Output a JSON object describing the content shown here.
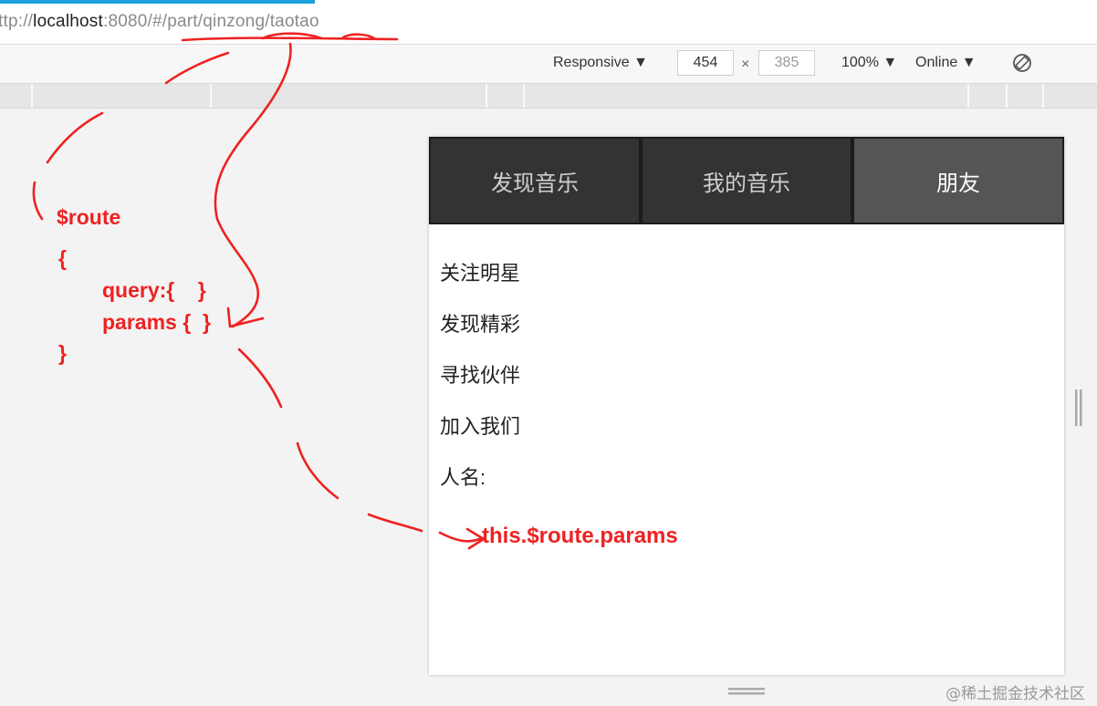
{
  "browser": {
    "url_prefix": "ttp://",
    "url_host": "localhost",
    "url_rest": ":8080/#/part/qinzong/taotao"
  },
  "devtools": {
    "device": "Responsive",
    "width": "454",
    "times": "×",
    "height": "385",
    "zoom": "100%",
    "network": "Online"
  },
  "app": {
    "tabs": [
      {
        "label": "发现音乐"
      },
      {
        "label": "我的音乐"
      },
      {
        "label": "朋友"
      }
    ],
    "list": [
      "关注明星",
      "发现精彩",
      "寻找伙伴",
      "加入我们",
      "人名:"
    ]
  },
  "annotations": {
    "route": "$route",
    "open_brace": "{",
    "query": "query:{    }",
    "params": "params {  }",
    "close_brace": "}",
    "params_access": "this.$route.params"
  },
  "colors": {
    "annotation": "#ee2222",
    "nav_bg": "#333333",
    "nav_active": "#555555",
    "accent": "#1a9fd9"
  },
  "watermark": "@稀土掘金技术社区"
}
